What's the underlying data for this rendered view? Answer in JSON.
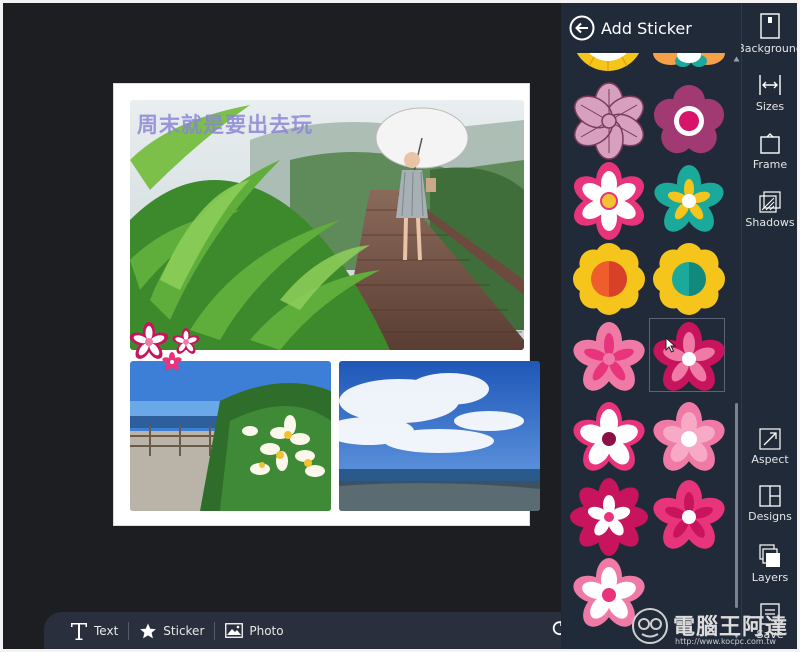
{
  "panel": {
    "title": "Add Sticker"
  },
  "canvas": {
    "overlay_text": "周末就是要出去玩"
  },
  "toolbar": {
    "text_label": "Text",
    "sticker_label": "Sticker",
    "photo_label": "Photo"
  },
  "rail": {
    "background_label": "Background",
    "sizes_label": "Sizes",
    "frame_label": "Frame",
    "shadows_label": "Shadows",
    "aspect_label": "Aspect",
    "designs_label": "Designs",
    "layers_label": "Layers",
    "save_label": "Save"
  },
  "watermark": {
    "text": "電腦王阿達",
    "url": "http://www.kocpc.com.tw"
  },
  "colors": {
    "panel_bg": "#212a38",
    "canvas_bg": "#1d1e21",
    "toolbar_bg": "#2a2f3d",
    "pink": "#e8347a",
    "light_pink": "#f07aa6",
    "magenta": "#c8145c",
    "yellow": "#f6c51c",
    "teal": "#1aa99a",
    "orange": "#ef5d2d"
  }
}
